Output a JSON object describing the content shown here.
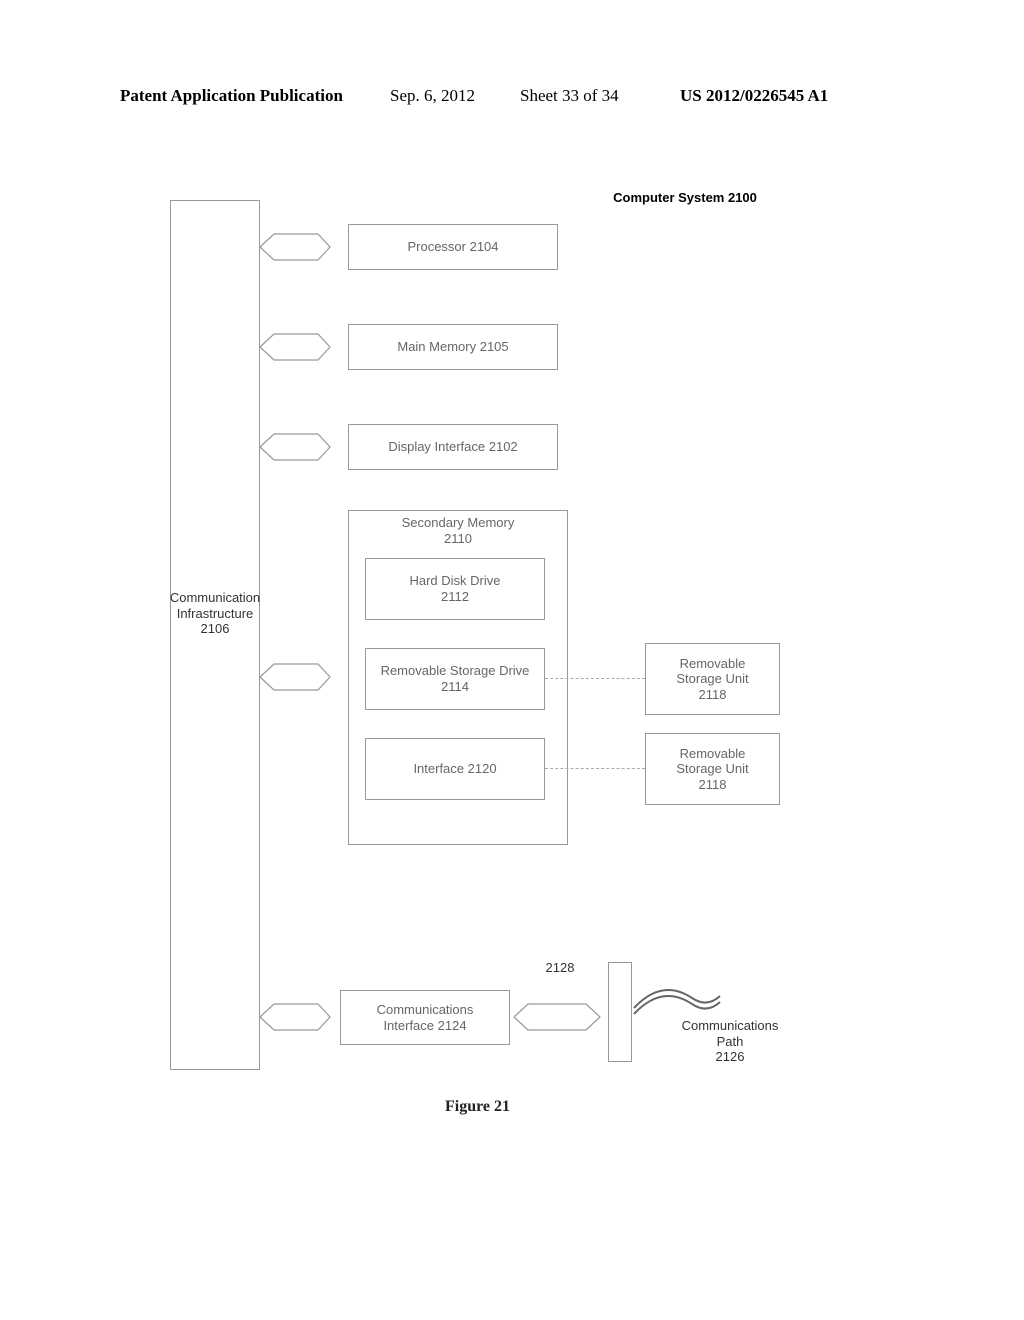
{
  "header": {
    "left": "Patent Application Publication",
    "mid_date": "Sep. 6, 2012",
    "mid_sheet": "Sheet 33 of 34",
    "right": "US 2012/0226545 A1"
  },
  "system_title": "Computer System 2100",
  "bus_label": {
    "l1": "Communication",
    "l2": "Infrastructure",
    "l3": "2106"
  },
  "processor": "Processor 2104",
  "main_memory": "Main Memory 2105",
  "display_interface": "Display Interface 2102",
  "secondary_memory_title": {
    "l1": "Secondary Memory",
    "l2": "2110"
  },
  "hard_disk": {
    "l1": "Hard Disk Drive",
    "l2": "2112"
  },
  "removable_drive": {
    "l1": "Removable Storage Drive",
    "l2": "2114"
  },
  "interface_box": "Interface 2120",
  "rsu_top": {
    "l1": "Removable",
    "l2": "Storage Unit",
    "l3": "2118"
  },
  "rsu_bottom": {
    "l1": "Removable",
    "l2": "Storage Unit",
    "l3": "2118"
  },
  "comm_interface": {
    "l1": "Communications",
    "l2": "Interface 2124"
  },
  "bus_arrow_label": "2128",
  "comm_path": {
    "l1": "Communications",
    "l2": "Path",
    "l3": "2126"
  },
  "figure": "Figure 21"
}
